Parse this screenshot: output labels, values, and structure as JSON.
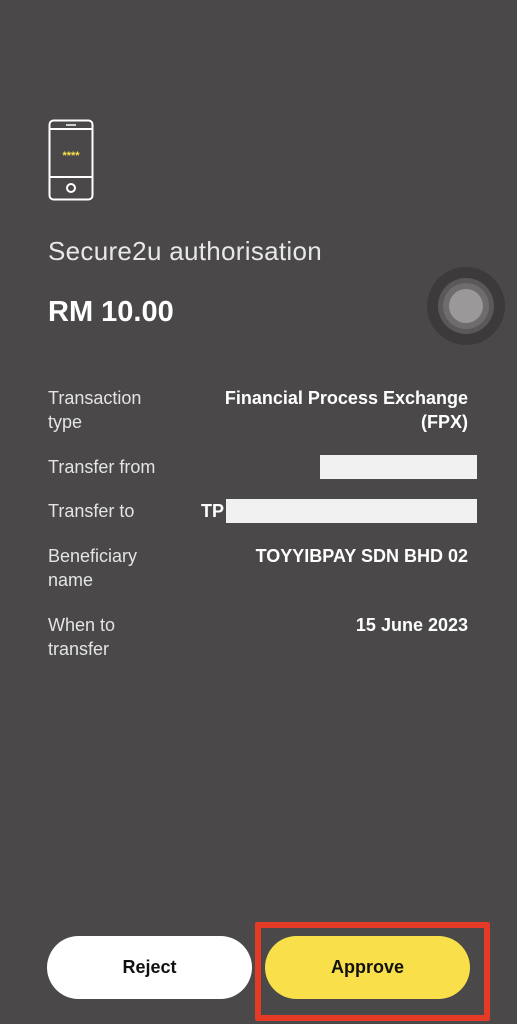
{
  "header": {
    "icon": "phone-pin-icon",
    "pin_mask": "****",
    "title": "Secure2u authorisation"
  },
  "amount": "RM 10.00",
  "fingerprint_icon": "fingerprint-icon",
  "details": {
    "transaction_type": {
      "label": "Transaction type",
      "value": "Financial Process Exchange (FPX)"
    },
    "transfer_from": {
      "label": "Transfer from",
      "value": ""
    },
    "transfer_to": {
      "label": "Transfer to",
      "value": "TP"
    },
    "beneficiary_name": {
      "label": "Beneficiary name",
      "value": "TOYYIBPAY SDN BHD 02"
    },
    "when_to_transfer": {
      "label": "When to transfer",
      "value": "15 June 2023"
    }
  },
  "actions": {
    "reject_label": "Reject",
    "approve_label": "Approve"
  },
  "colors": {
    "background": "#4a4849",
    "approve": "#f9e04a",
    "highlight": "#e53a26",
    "pin_mask": "#f9e04a"
  }
}
